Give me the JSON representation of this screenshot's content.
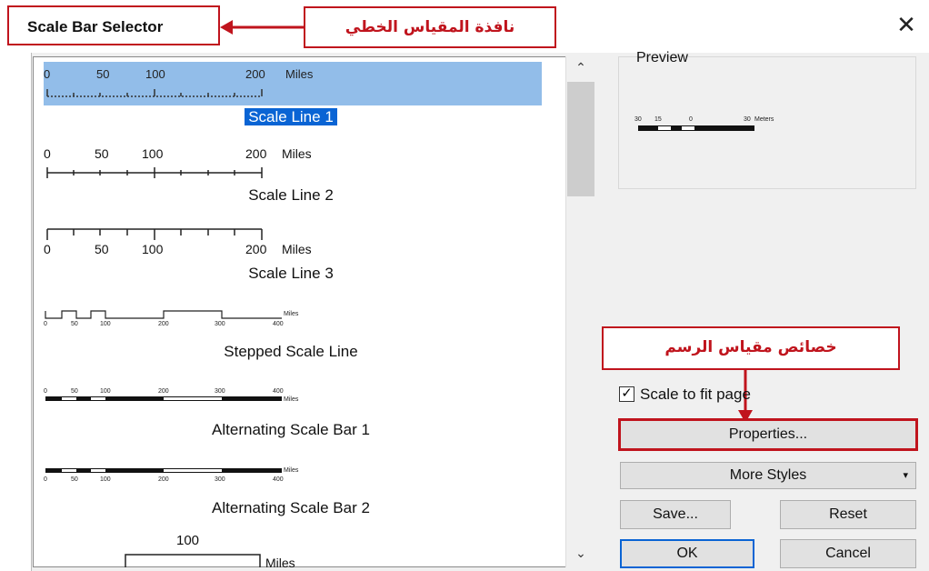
{
  "window": {
    "title": "Scale Bar Selector",
    "close_glyph": "✕"
  },
  "annotations": {
    "window_note": "نافذة المقياس الخطي",
    "properties_note": "خصائص مقياس الرسم"
  },
  "styles_list": {
    "items": [
      {
        "label": "Scale Line 1",
        "selected": true,
        "ticks": [
          "0",
          "50",
          "100",
          "200"
        ],
        "unit": "Miles"
      },
      {
        "label": "Scale Line 2",
        "ticks": [
          "0",
          "50",
          "100",
          "200"
        ],
        "unit": "Miles"
      },
      {
        "label": "Scale Line 3",
        "ticks": [
          "0",
          "50",
          "100",
          "200"
        ],
        "unit": "Miles"
      },
      {
        "label": "Stepped Scale Line",
        "ticks": [
          "0",
          "50",
          "100",
          "200",
          "300",
          "400"
        ],
        "unit": "Miles"
      },
      {
        "label": "Alternating Scale Bar 1",
        "ticks": [
          "0",
          "50",
          "100",
          "200",
          "300",
          "400"
        ],
        "unit": "Miles"
      },
      {
        "label": "Alternating Scale Bar 2",
        "ticks": [
          "0",
          "50",
          "100",
          "200",
          "300",
          "400"
        ],
        "unit": "Miles"
      },
      {
        "label": "",
        "ticks": [
          "100"
        ],
        "unit": "Miles"
      }
    ]
  },
  "preview": {
    "title": "Preview",
    "ticks": [
      "30",
      "15",
      "0",
      "30"
    ],
    "unit": "Meters"
  },
  "options": {
    "scale_to_fit": {
      "label": "Scale to fit page",
      "checked": true
    }
  },
  "buttons": {
    "properties": "Properties...",
    "more_styles": "More Styles",
    "save": "Save...",
    "reset": "Reset",
    "ok": "OK",
    "cancel": "Cancel"
  },
  "colors": {
    "annotation": "#c0141d",
    "selection": "#0a64d4"
  }
}
